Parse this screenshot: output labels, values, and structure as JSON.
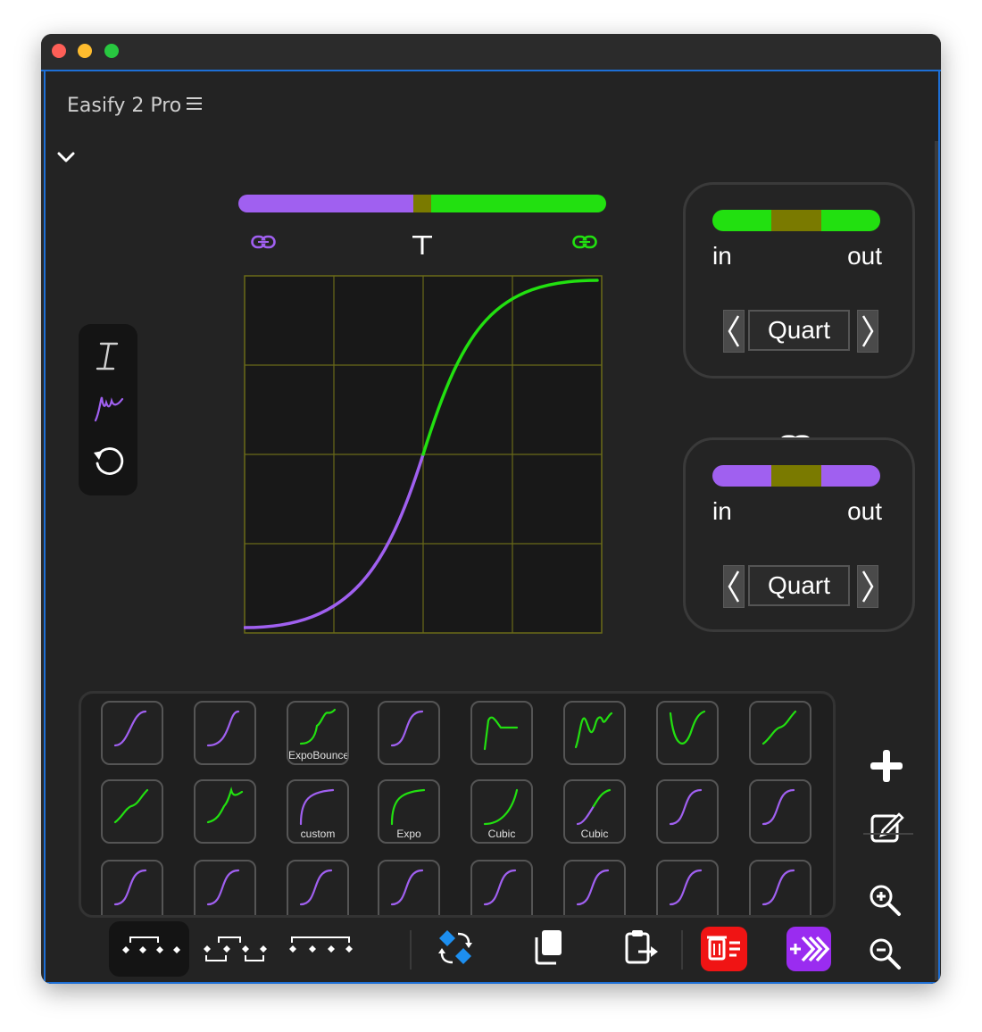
{
  "window": {
    "title": "Easify 2 Pro"
  },
  "colors": {
    "purple": "#a060f0",
    "green": "#22e010",
    "olive": "#7a7a00",
    "grid": "#6a6a18"
  },
  "ease_in": {
    "in_label": "in",
    "out_label": "out",
    "name": "Quart"
  },
  "ease_out": {
    "in_label": "in",
    "out_label": "out",
    "name": "Quart"
  },
  "presets": [
    {
      "label": ""
    },
    {
      "label": ""
    },
    {
      "label": "ExpoBounce"
    },
    {
      "label": ""
    },
    {
      "label": ""
    },
    {
      "label": ""
    },
    {
      "label": ""
    },
    {
      "label": ""
    },
    {
      "label": ""
    },
    {
      "label": ""
    },
    {
      "label": "custom"
    },
    {
      "label": "Expo"
    },
    {
      "label": "Cubic"
    },
    {
      "label": "Cubic"
    },
    {
      "label": ""
    },
    {
      "label": ""
    },
    {
      "label": ""
    },
    {
      "label": ""
    },
    {
      "label": ""
    },
    {
      "label": ""
    },
    {
      "label": ""
    },
    {
      "label": ""
    },
    {
      "label": ""
    },
    {
      "label": ""
    }
  ],
  "icons": {
    "menu": "hamburger-icon",
    "collapse": "chevron-down-icon",
    "link": "link-icon",
    "text_tool": "text-cursor-icon",
    "curve_tool": "curve-draw-icon",
    "reset": "reset-icon",
    "add": "plus-icon",
    "edit": "edit-icon",
    "zoom_in": "zoom-in-icon",
    "zoom_out": "zoom-out-icon",
    "swap": "swap-keyframes-icon",
    "copy": "copy-icon",
    "paste": "paste-icon",
    "delete": "delete-icon",
    "apply": "apply-icon"
  }
}
